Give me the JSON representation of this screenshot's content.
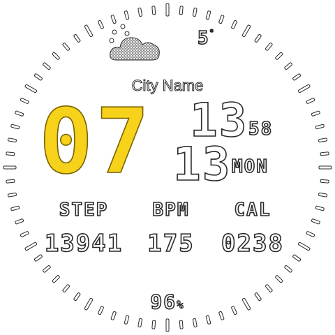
{
  "weather": {
    "icon": "snow-cloud-icon",
    "temperature": "5",
    "temperature_unit": "°"
  },
  "location": {
    "city": "City Name"
  },
  "time": {
    "hour": "07",
    "minute": "13",
    "second": "58"
  },
  "date": {
    "day": "13",
    "weekday": "MON"
  },
  "stats": {
    "step": {
      "label": "STEP",
      "value": "13941"
    },
    "bpm": {
      "label": "BPM",
      "value": "175"
    },
    "cal": {
      "label": "CAL",
      "value": "0238"
    }
  },
  "battery": {
    "value": "96",
    "unit": "%"
  },
  "colors": {
    "accent": "#f6d21b",
    "ink": "#2a2a2a",
    "background": "#ffffff"
  }
}
